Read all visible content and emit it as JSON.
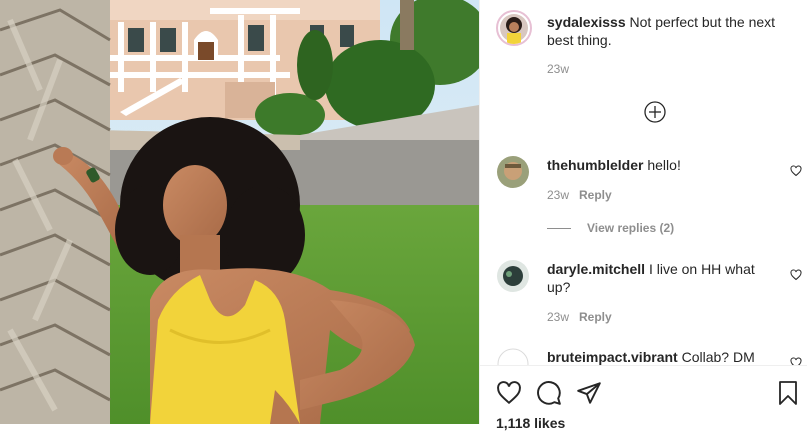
{
  "post": {
    "author": "sydalexisss",
    "caption": "Not perfect but the next best thing.",
    "age": "23w"
  },
  "load_more_icon": "plus-circle-icon",
  "comments": [
    {
      "user": "thehumblelder",
      "text": "hello!",
      "age": "23w",
      "reply": "Reply"
    },
    {
      "user": "daryle.mitchell",
      "text": "I live on HH what up?",
      "age": "23w",
      "reply": "Reply"
    },
    {
      "user": "bruteimpact.vibrant",
      "text": "Collab? DM"
    }
  ],
  "view_replies": "View replies (2)",
  "actions": {
    "like_icon": "heart-icon",
    "comment_icon": "comment-icon",
    "share_icon": "paper-plane-icon",
    "save_icon": "bookmark-icon"
  },
  "likes": "1,118 likes",
  "colors": {
    "text": "#262626",
    "muted": "#8e8e8e",
    "border": "#efefef"
  }
}
